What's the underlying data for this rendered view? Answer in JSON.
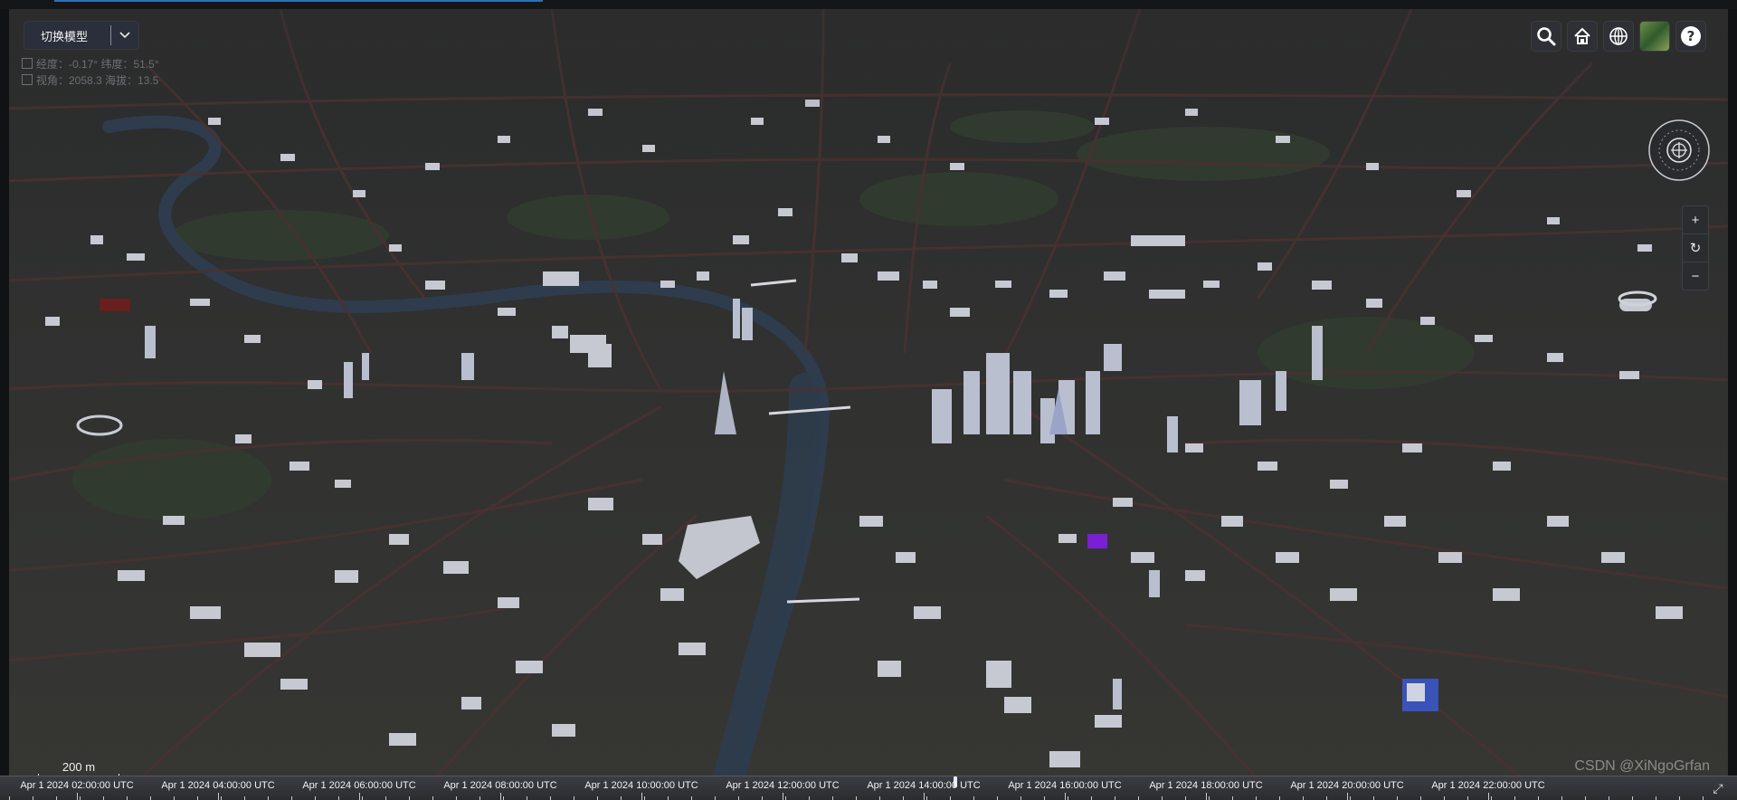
{
  "toolbar": {
    "model_switch_label": "切换模型",
    "buttons": [
      {
        "name": "search-button",
        "icon": "search-icon"
      },
      {
        "name": "home-button",
        "icon": "home-icon"
      },
      {
        "name": "scene-mode-button",
        "icon": "globe-icon"
      },
      {
        "name": "base-layer-picker-button",
        "icon": "imagery-icon"
      },
      {
        "name": "help-button",
        "icon": "help-icon"
      }
    ]
  },
  "readouts": {
    "line1": "经度：-0.17° 纬度：51.5°",
    "line2": "视角：2058.3 海拔：13.5"
  },
  "navigation": {
    "zoom_in": "+",
    "reset": "↻",
    "zoom_out": "−"
  },
  "scale_bar": {
    "label": "200 m"
  },
  "timeline": {
    "ticks": [
      "Apr 1 2024 02:00:00 UTC",
      "Apr 1 2024 04:00:00 UTC",
      "Apr 1 2024 06:00:00 UTC",
      "Apr 1 2024 08:00:00 UTC",
      "Apr 1 2024 10:00:00 UTC",
      "Apr 1 2024 12:00:00 UTC",
      "Apr 1 2024 14:00:00 UTC",
      "Apr 1 2024 16:00:00 UTC",
      "Apr 1 2024 18:00:00 UTC",
      "Apr 1 2024 20:00:00 UTC",
      "Apr 1 2024 22:00:00 UTC"
    ]
  },
  "watermark": "CSDN @XiNgoGrfan",
  "colors": {
    "road": "#4a3131",
    "river": "#2c3a4a",
    "building": "#c9ccd6",
    "accent_purple": "#7a1fd6"
  }
}
